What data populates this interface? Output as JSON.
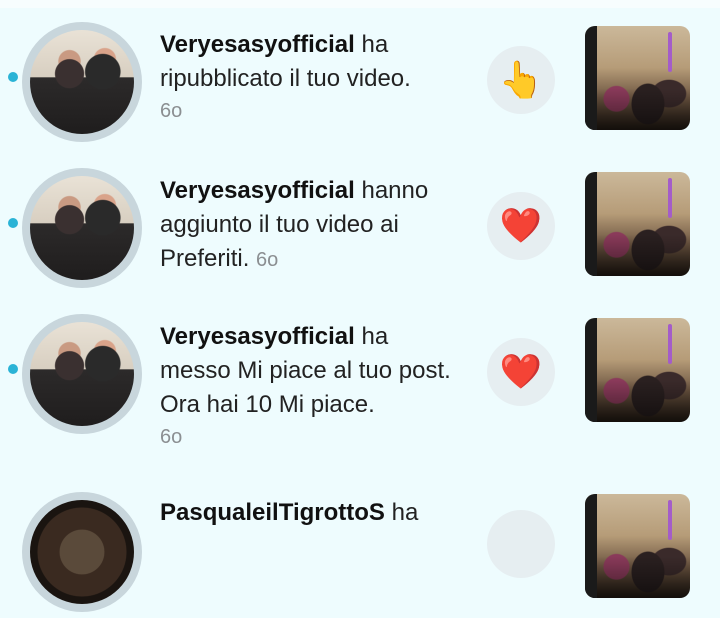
{
  "notifications": [
    {
      "username": "Veryesasyofficial",
      "message": " ha ripubblicato il tuo video.",
      "time": "6o",
      "reaction": "pointing-hand-icon",
      "reaction_glyph": "👆"
    },
    {
      "username": "Veryesasyofficial",
      "message": " hanno aggiunto il tuo video ai Preferiti.",
      "time": "6o",
      "reaction": "heart-icon",
      "reaction_glyph": "❤️"
    },
    {
      "username": "Veryesasyofficial",
      "message": " ha messo Mi piace al tuo post. Ora hai 10 Mi piace.",
      "time": "6o",
      "reaction": "heart-icon",
      "reaction_glyph": "❤️"
    },
    {
      "username": "PasqualeilTigrottoS",
      "message": " ha"
    }
  ],
  "colors": {
    "unread_dot": "#2ab3d6",
    "background": "#eefcfe"
  }
}
